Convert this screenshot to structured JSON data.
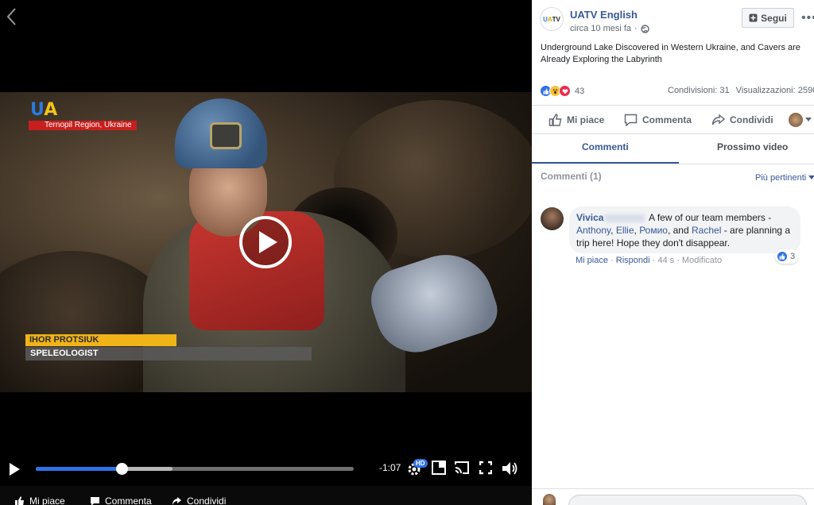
{
  "video": {
    "logo_u": "U",
    "logo_a": "A",
    "region": "Ternopil Region, Ukraine",
    "lower_third_name": "IHOR PROTSIUK",
    "lower_third_title": "SPELEOLOGIST",
    "progress_played": 0.27,
    "progress_buffered": 0.43,
    "time_remaining": "-1:07",
    "hd_badge": "HD",
    "actions": {
      "like": "Mi piace",
      "comment": "Commenta",
      "share": "Condividi"
    }
  },
  "post": {
    "page_name": "UATV English",
    "avatar_u": "U",
    "avatar_a": "A",
    "avatar_tv": "TV",
    "time": "circa 10 mesi fa",
    "separator": "·",
    "follow_label": "Segui",
    "more": "•••",
    "text": "Underground Lake Discovered in Western Ukraine, and Cavers are Already Exploring the Labyrinth",
    "reaction_count": "43",
    "shares": "Condivisioni: 31",
    "views": "Visualizzazioni: 2590",
    "actions": {
      "like": "Mi piace",
      "comment": "Commenta",
      "share": "Condividi"
    }
  },
  "tabs": {
    "comments": "Commenti",
    "next_video": "Prossimo video"
  },
  "comments": {
    "title": "Commenti (1)",
    "sort": "Più pertinenti",
    "items": [
      {
        "author": "Vivica",
        "text_before": " A few of our team members - ",
        "mention1": "Anthony",
        "sep1": ", ",
        "mention2": "Ellie",
        "sep2": ", ",
        "mention3": "Ромио",
        "sep3": ", and ",
        "mention4": "Rachel",
        "text_after": " - are planning a trip here! Hope they don't disappear.",
        "reaction_count": "3",
        "like": "Mi piace",
        "reply": "Rispondi",
        "time": "44 s",
        "edited": "Modificato",
        "dot": " · "
      }
    ]
  },
  "colors": {
    "accent": "#385898",
    "progress": "#2f72e6",
    "love": "#f0284a",
    "lower_third": "#f0b418",
    "region_bg": "#c81e1e"
  }
}
